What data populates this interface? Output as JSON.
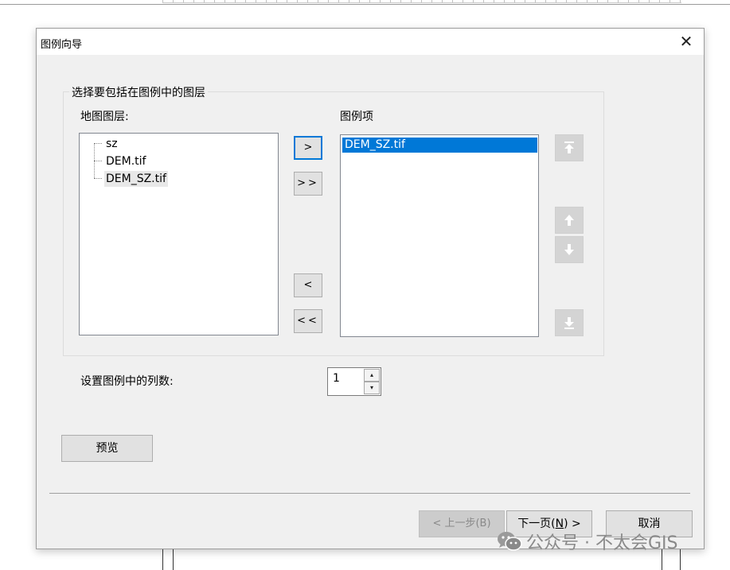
{
  "dialog": {
    "title": "图例向导",
    "close_glyph": "✕",
    "group_title": "选择要包括在图例中的图层",
    "map_layers_label": "地图图层:",
    "legend_items_label": "图例项",
    "map_layers": [
      "sz",
      "DEM.tif",
      "DEM_SZ.tif"
    ],
    "legend_items": [
      "DEM_SZ.tif"
    ],
    "add_one": ">",
    "add_all": ">>",
    "remove_one": "<",
    "remove_all": "<<",
    "columns_label": "设置图例中的列数:",
    "columns_value": "1",
    "spin_up_glyph": "▴",
    "spin_down_glyph": "▾",
    "preview_button": "预览",
    "back_button": "< 上一步(B)",
    "next_button_prefix": "下一页(",
    "next_button_mnemonic": "N",
    "next_button_suffix": ") >",
    "cancel_button": "取消"
  },
  "watermark": {
    "text": "公众号 · 不太会GIS",
    "icon": "wechat-icon"
  },
  "colors": {
    "selection": "#0078d7",
    "dialog_bg": "#f0f0f0"
  }
}
